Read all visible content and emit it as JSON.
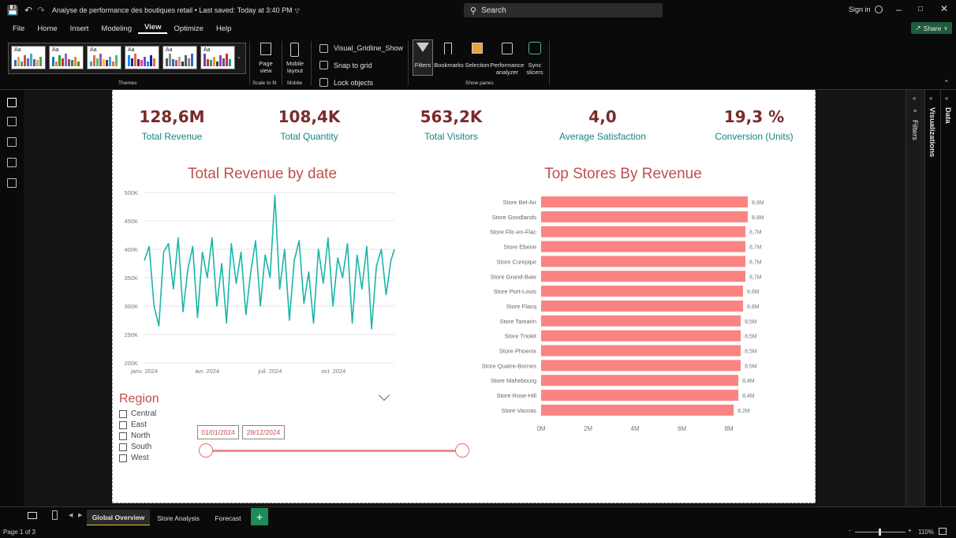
{
  "titlebar": {
    "doc_title": "Analyse de performance des boutiques retail • Last saved: Today at 3:40 PM",
    "search_placeholder": "Search",
    "sign_in": "Sign in"
  },
  "menu": {
    "items": [
      "File",
      "Home",
      "Insert",
      "Modeling",
      "View",
      "Optimize",
      "Help"
    ],
    "active": "View",
    "share_label": "Share"
  },
  "ribbon": {
    "themes_label": "Themes",
    "page_view": "Page view",
    "scale_to_fit": "Scale to fit",
    "mobile_layout": "Mobile layout",
    "mobile": "Mobile",
    "visual_gridline": "Visual_Gridline_Show",
    "snap_to_grid": "Snap to grid",
    "lock_objects": "Lock objects",
    "filters": "Filters",
    "bookmarks": "Bookmarks",
    "selection": "Selection",
    "performance_analyzer": "Performance analyzer",
    "sync_slicers": "Sync slicers",
    "show_panes": "Show panes",
    "theme_sample_text": "Aa"
  },
  "kpis": [
    {
      "value": "128,6M",
      "label": "Total Revenue"
    },
    {
      "value": "108,4K",
      "label": "Total Quantity"
    },
    {
      "value": "563,2K",
      "label": "Total Visitors"
    },
    {
      "value": "4,0",
      "label": "Average Satisfaction"
    },
    {
      "value": "19,3 %",
      "label": "Conversion (Units)"
    }
  ],
  "chart_data": [
    {
      "type": "line",
      "title": "Total Revenue by date",
      "x_ticks": [
        "janv. 2024",
        "avr. 2024",
        "juil. 2024",
        "oct. 2024"
      ],
      "y_ticks": [
        "200K",
        "250K",
        "300K",
        "350K",
        "400K",
        "450K",
        "500K"
      ],
      "ylim": [
        200000,
        500000
      ],
      "xlim": [
        "2024-01-01",
        "2024-12-28"
      ],
      "grid": true,
      "color": "#1ab5a8",
      "series": [
        {
          "x": [
            "2024-01-01",
            "2024-01-08",
            "2024-01-15",
            "2024-01-22",
            "2024-01-29",
            "2024-02-05",
            "2024-02-12",
            "2024-02-19",
            "2024-02-26",
            "2024-03-04",
            "2024-03-11",
            "2024-03-18",
            "2024-03-25",
            "2024-04-01",
            "2024-04-08",
            "2024-04-15",
            "2024-04-22",
            "2024-04-29",
            "2024-05-06",
            "2024-05-13",
            "2024-05-20",
            "2024-05-27",
            "2024-06-03",
            "2024-06-10",
            "2024-06-17",
            "2024-06-24",
            "2024-07-01",
            "2024-07-08",
            "2024-07-15",
            "2024-07-22",
            "2024-07-29",
            "2024-08-05",
            "2024-08-12",
            "2024-08-19",
            "2024-08-26",
            "2024-09-02",
            "2024-09-09",
            "2024-09-16",
            "2024-09-23",
            "2024-09-30",
            "2024-10-07",
            "2024-10-14",
            "2024-10-21",
            "2024-10-28",
            "2024-11-04",
            "2024-11-11",
            "2024-11-18",
            "2024-11-25",
            "2024-12-02",
            "2024-12-09",
            "2024-12-16",
            "2024-12-23",
            "2024-12-28"
          ],
          "y": [
            380000,
            405000,
            300000,
            265000,
            395000,
            410000,
            330000,
            420000,
            290000,
            365000,
            405000,
            280000,
            395000,
            350000,
            420000,
            300000,
            375000,
            270000,
            410000,
            340000,
            395000,
            285000,
            360000,
            415000,
            300000,
            390000,
            350000,
            495000,
            330000,
            400000,
            275000,
            380000,
            415000,
            305000,
            360000,
            270000,
            400000,
            340000,
            420000,
            300000,
            385000,
            350000,
            410000,
            270000,
            390000,
            330000,
            405000,
            260000,
            370000,
            400000,
            320000,
            380000,
            400000
          ]
        }
      ]
    },
    {
      "type": "bar",
      "orientation": "horizontal",
      "title": "Top Stores By Revenue",
      "categories": [
        "Store Bel-Air",
        "Store Goodlands",
        "Store Flic-en-Flac",
        "Store Ebene",
        "Store Curepipe",
        "Store Grand-Baie",
        "Store Port-Louis",
        "Store Flacq",
        "Store Tamarin",
        "Store Triolet",
        "Store Phoenix",
        "Store Quatre-Bornes",
        "Store Mahebourg",
        "Store Rose-Hill",
        "Store Vacoas"
      ],
      "values": [
        8.8,
        8.8,
        8.7,
        8.7,
        8.7,
        8.7,
        8.6,
        8.6,
        8.5,
        8.5,
        8.5,
        8.5,
        8.4,
        8.4,
        8.2
      ],
      "value_labels": [
        "8,8M",
        "8,8M",
        "8,7M",
        "8,7M",
        "8,7M",
        "8,7M",
        "8,6M",
        "8,6M",
        "8,5M",
        "8,5M",
        "8,5M",
        "8,5M",
        "8,4M",
        "8,4M",
        "8,2M"
      ],
      "x_ticks": [
        "0M",
        "2M",
        "4M",
        "6M",
        "8M"
      ],
      "xlim": [
        0,
        9
      ],
      "color": "#fa8481",
      "grid": false
    }
  ],
  "region_slicer": {
    "title": "Region",
    "items": [
      "Central",
      "East",
      "North",
      "South",
      "West"
    ]
  },
  "date_slicer": {
    "start": "01/01/2024",
    "end": "28/12/2024"
  },
  "panes": {
    "filters": "Filters",
    "visualizations": "Visualizations",
    "data": "Data"
  },
  "tabs": {
    "items": [
      "Global Overview",
      "Store Analysis",
      "Forecast"
    ],
    "active": "Global Overview",
    "add": "+"
  },
  "status": {
    "page": "Page 1 of 3",
    "zoom": "110%"
  }
}
